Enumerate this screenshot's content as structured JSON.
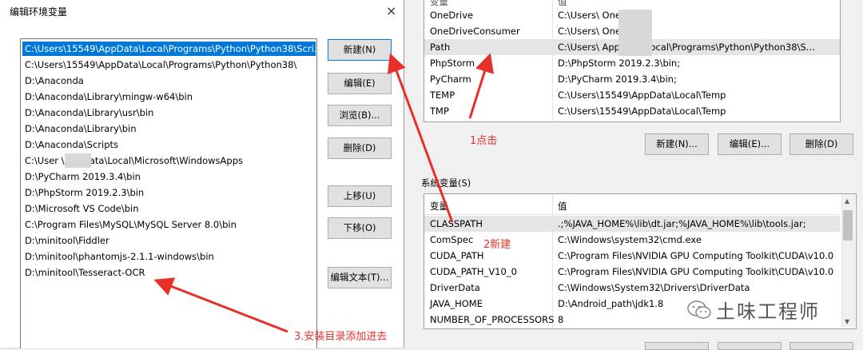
{
  "dialog": {
    "title": "编辑环境变量",
    "close": "×",
    "paths": [
      "C:\\Users\\15549\\AppData\\Local\\Programs\\Python\\Python38\\Scri...",
      "C:\\Users\\15549\\AppData\\Local\\Programs\\Python\\Python38\\",
      "D:\\Anaconda",
      "D:\\Anaconda\\Library\\mingw-w64\\bin",
      "D:\\Anaconda\\Library\\usr\\bin",
      "D:\\Anaconda\\Library\\bin",
      "D:\\Anaconda\\Scripts",
      "C:\\User          \\AppData\\Local\\Microsoft\\WindowsApps",
      "D:\\PyCharm 2019.3.4\\bin",
      "D:\\PhpStorm 2019.2.3\\bin",
      "D:\\Microsoft VS Code\\bin",
      "C:\\Program Files\\MySQL\\MySQL Server 8.0\\bin",
      "D:\\minitool\\Fiddler",
      "D:\\minitool\\phantomjs-2.1.1-windows\\bin",
      "D:\\minitool\\Tesseract-OCR"
    ],
    "buttons": {
      "new": "新建(N)",
      "edit": "编辑(E)",
      "browse": "浏览(B)...",
      "delete": "删除(D)",
      "up": "上移(U)",
      "down": "下移(O)",
      "edit_text": "编辑文本(T)..."
    }
  },
  "user_vars": {
    "header_var": "变量",
    "header_val": "值",
    "rows": [
      {
        "k": "OneDrive",
        "v": "C:\\Users\\          OneDrive"
      },
      {
        "k": "OneDriveConsumer",
        "v": "C:\\Users\\          OneDrive"
      },
      {
        "k": "Path",
        "v": "C:\\Users\\          AppData\\Local\\Programs\\Python\\Python38\\S..."
      },
      {
        "k": "PhpStorm",
        "v": "D:\\PhpStorm 2019.2.3\\bin;"
      },
      {
        "k": "PyCharm",
        "v": "D:\\PyCharm 2019.3.4\\bin;"
      },
      {
        "k": "TEMP",
        "v": "C:\\Users\\15549\\AppData\\Local\\Temp"
      },
      {
        "k": "TMP",
        "v": "C:\\Users\\15549\\AppData\\Local\\Temp"
      }
    ],
    "buttons": {
      "new": "新建(N)...",
      "edit": "编辑(E)...",
      "delete": "删除(D)"
    }
  },
  "system_vars": {
    "label": "系统变量(S)",
    "header_var": "变量",
    "header_val": "值",
    "rows": [
      {
        "k": "CLASSPATH",
        "v": ".;%JAVA_HOME%\\lib\\dt.jar;%JAVA_HOME%\\lib\\tools.jar;"
      },
      {
        "k": "ComSpec",
        "v": "C:\\Windows\\system32\\cmd.exe"
      },
      {
        "k": "CUDA_PATH",
        "v": "C:\\Program Files\\NVIDIA GPU Computing Toolkit\\CUDA\\v10.0"
      },
      {
        "k": "CUDA_PATH_V10_0",
        "v": "C:\\Program Files\\NVIDIA GPU Computing Toolkit\\CUDA\\v10.0"
      },
      {
        "k": "DriverData",
        "v": "C:\\Windows\\System32\\Drivers\\DriverData"
      },
      {
        "k": "JAVA_HOME",
        "v": "D:\\Android_path\\jdk1.8"
      },
      {
        "k": "NUMBER_OF_PROCESSORS",
        "v": "8"
      }
    ]
  },
  "annotations": {
    "step1": "1点击",
    "step2": "2新建",
    "step3": "3.安装目录添加进去",
    "color": "#e8302a"
  },
  "watermark": {
    "text": "土味工程师",
    "icon": "wechat-icon"
  }
}
